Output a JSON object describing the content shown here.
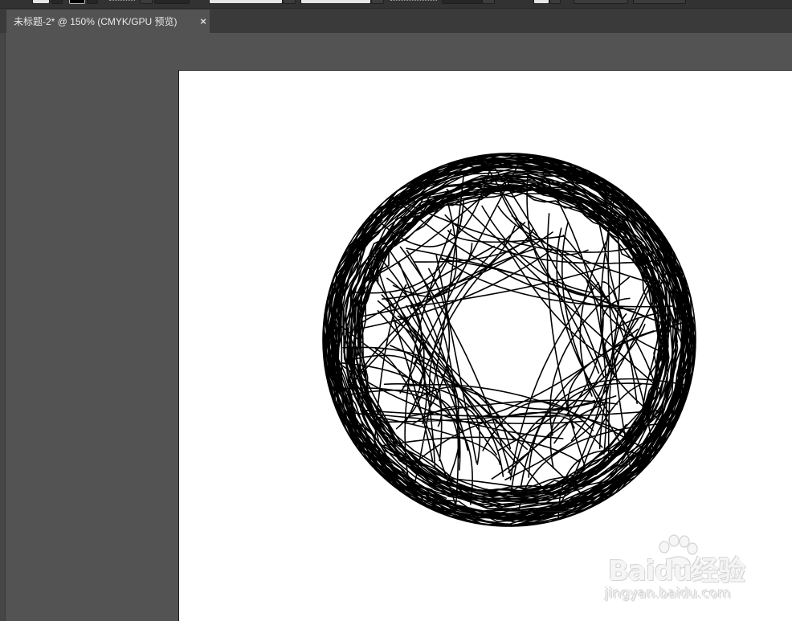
{
  "document_tab": {
    "title": "未标题-2* @ 150% (CMYK/GPU 预览)",
    "close_glyph": "×"
  },
  "artwork": {
    "description_icon": "scribble-ball-artwork",
    "stroke_color": "#000000",
    "fill_color": "#ffffff"
  },
  "watermark": {
    "logo_text": "Baidu经验",
    "url_text": "jingyan.baidu.com"
  },
  "colors": {
    "workspace": "#535353",
    "panel_dark": "#323232",
    "artboard": "#ffffff"
  }
}
